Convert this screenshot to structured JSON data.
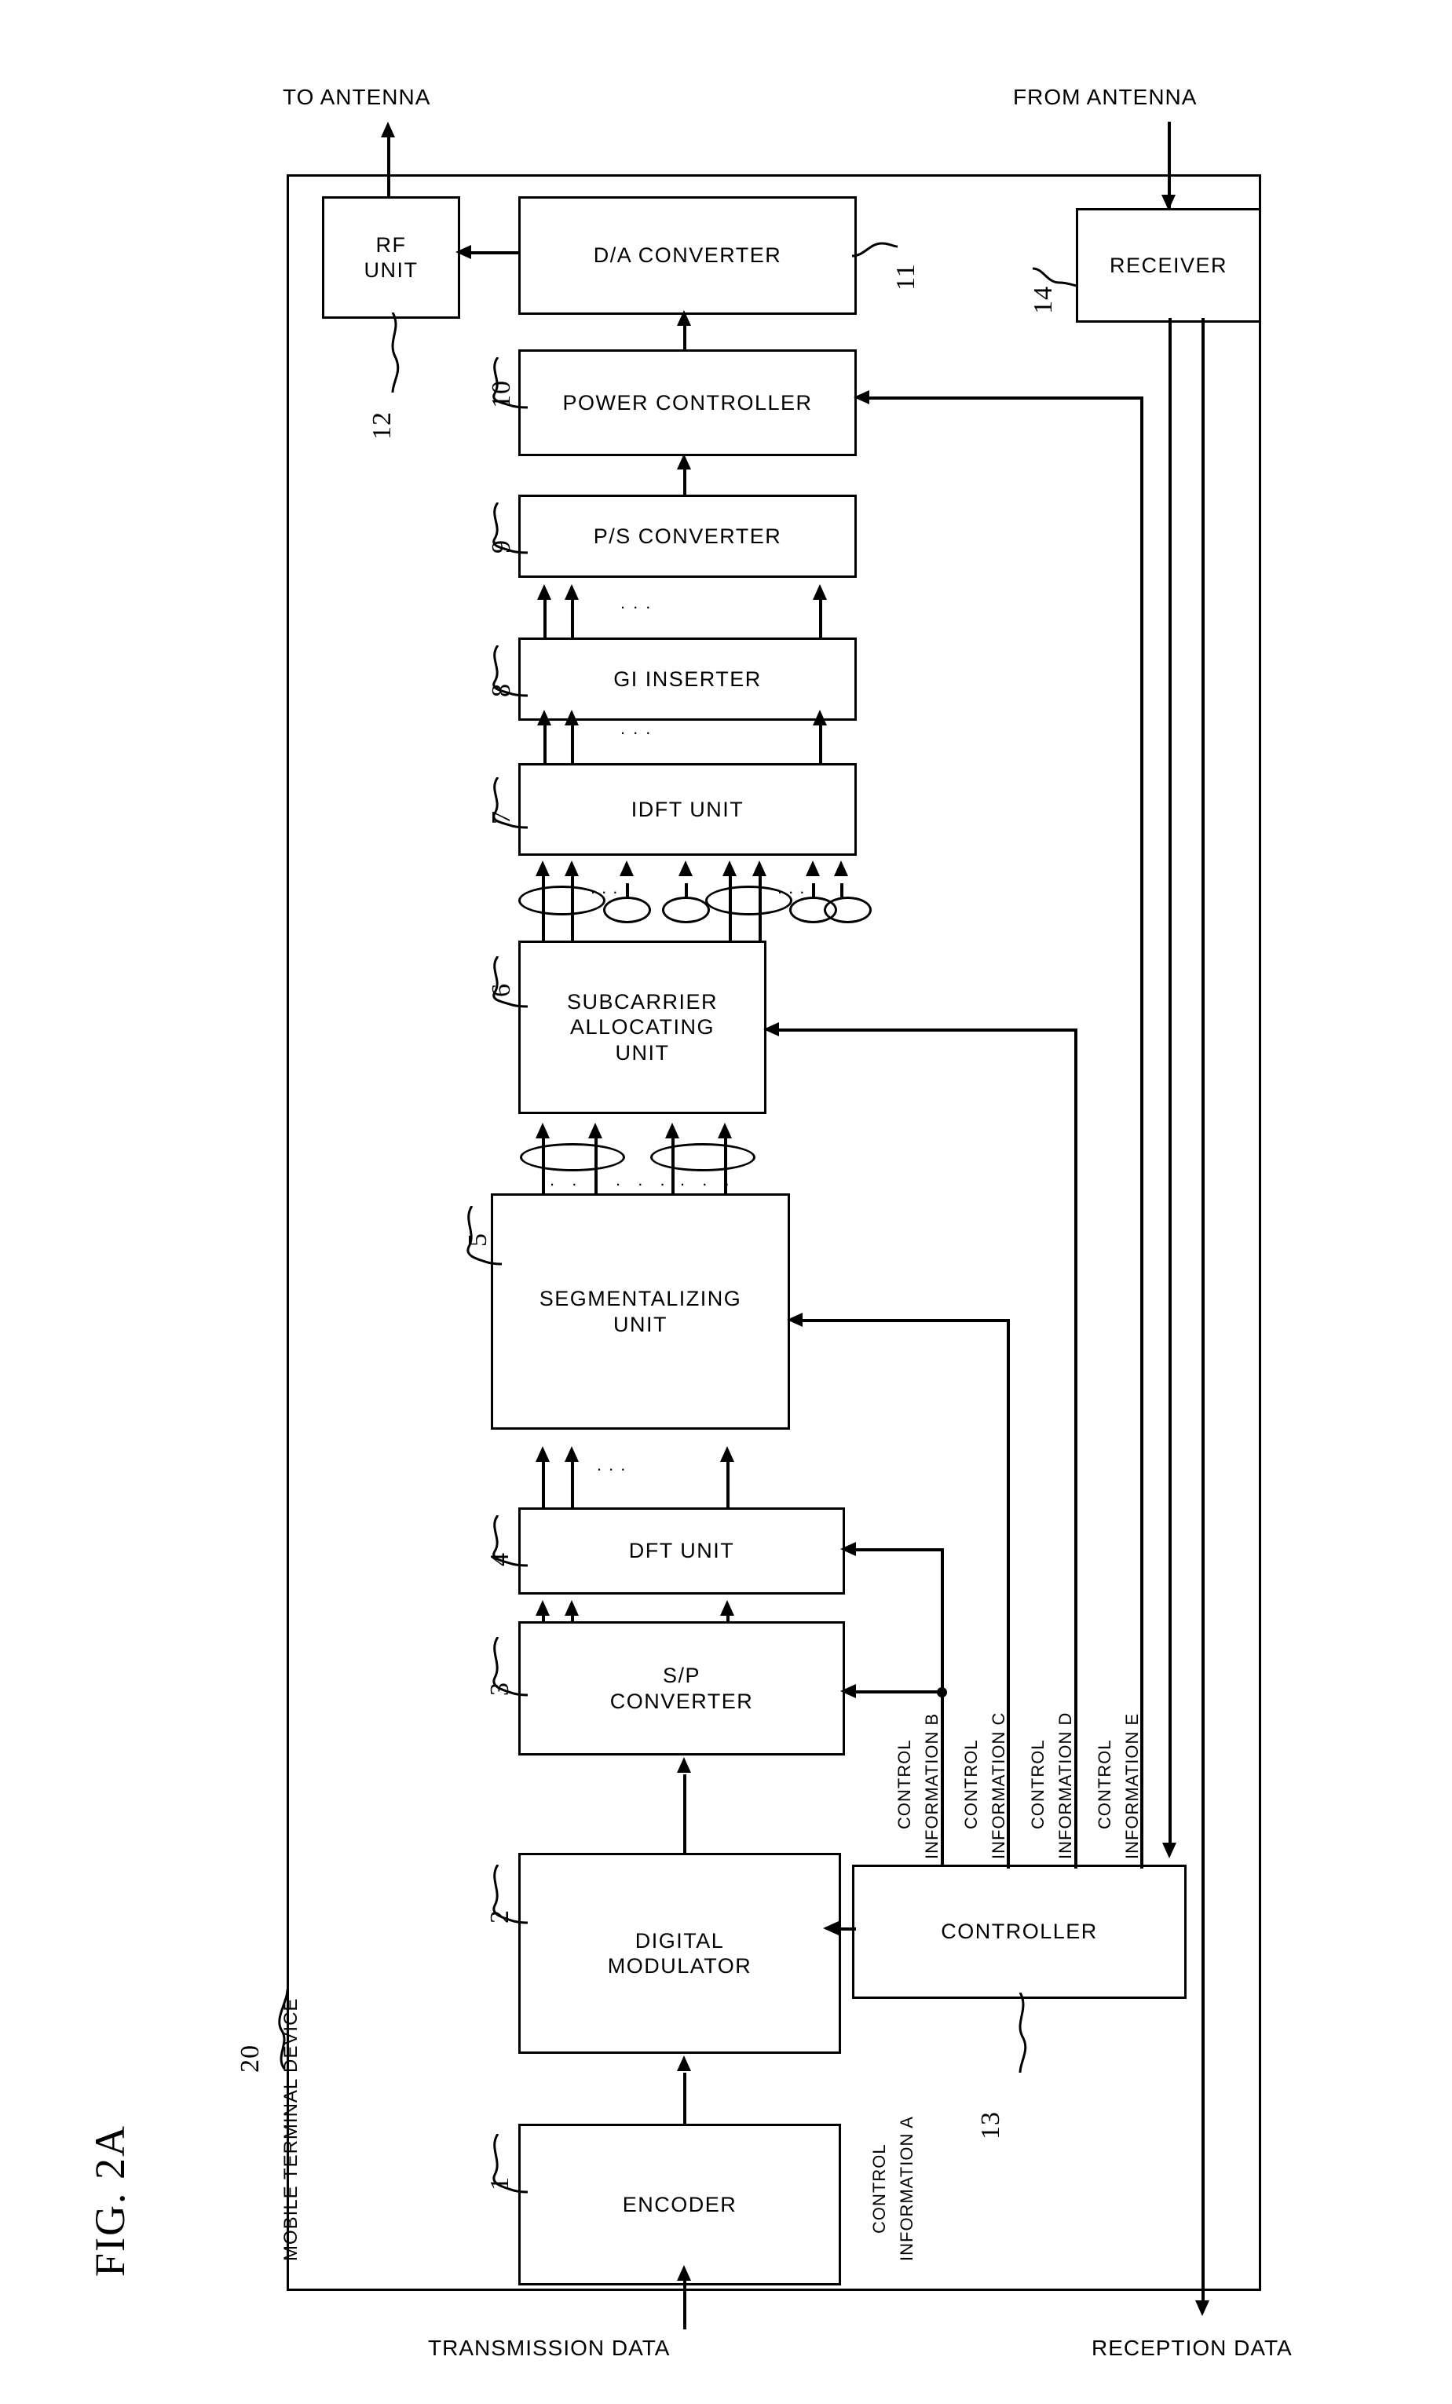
{
  "figure": {
    "label": "FIG. 2A",
    "device_label": "MOBILE TERMINAL DEVICE",
    "device_ref": "20"
  },
  "ports": {
    "to_antenna": "TO ANTENNA",
    "from_antenna": "FROM ANTENNA",
    "transmission_data": "TRANSMISSION DATA",
    "reception_data": "RECEPTION DATA"
  },
  "blocks": [
    {
      "id": "encoder",
      "label": "ENCODER",
      "ref": "1"
    },
    {
      "id": "digmod",
      "label": "DIGITAL\nMODULATOR",
      "ref": "2"
    },
    {
      "id": "sp",
      "label": "S/P\nCONVERTER",
      "ref": "3"
    },
    {
      "id": "dft",
      "label": "DFT UNIT",
      "ref": "4"
    },
    {
      "id": "segment",
      "label": "SEGMENTALIZING\nUNIT",
      "ref": "5"
    },
    {
      "id": "subcarrier",
      "label": "SUBCARRIER\nALLOCATING\nUNIT",
      "ref": "6"
    },
    {
      "id": "idft",
      "label": "IDFT UNIT",
      "ref": "7"
    },
    {
      "id": "gi",
      "label": "GI INSERTER",
      "ref": "8"
    },
    {
      "id": "ps",
      "label": "P/S CONVERTER",
      "ref": "9"
    },
    {
      "id": "power",
      "label": "POWER CONTROLLER",
      "ref": "10"
    },
    {
      "id": "da",
      "label": "D/A CONVERTER",
      "ref": "11"
    },
    {
      "id": "rf",
      "label": "RF\nUNIT",
      "ref": "12"
    },
    {
      "id": "controller",
      "label": "CONTROLLER",
      "ref": "13"
    },
    {
      "id": "receiver",
      "label": "RECEIVER",
      "ref": "14"
    }
  ],
  "control_signals": [
    {
      "id": "a",
      "line1": "CONTROL",
      "line2": "INFORMATION A",
      "target": "DIGITAL MODULATOR"
    },
    {
      "id": "b",
      "line1": "CONTROL",
      "line2": "INFORMATION B",
      "target": "S/P CONVERTER, DFT UNIT"
    },
    {
      "id": "c",
      "line1": "CONTROL",
      "line2": "INFORMATION C",
      "target": "SEGMENTALIZING UNIT"
    },
    {
      "id": "d",
      "line1": "CONTROL",
      "line2": "INFORMATION D",
      "target": "SUBCARRIER ALLOCATING UNIT"
    },
    {
      "id": "e",
      "line1": "CONTROL",
      "line2": "INFORMATION E",
      "target": "POWER CONTROLLER"
    }
  ],
  "bus_dots": [
    "...",
    "...",
    "...",
    "...",
    "..."
  ],
  "colors": {
    "ink": "#000000",
    "paper": "#ffffff"
  }
}
